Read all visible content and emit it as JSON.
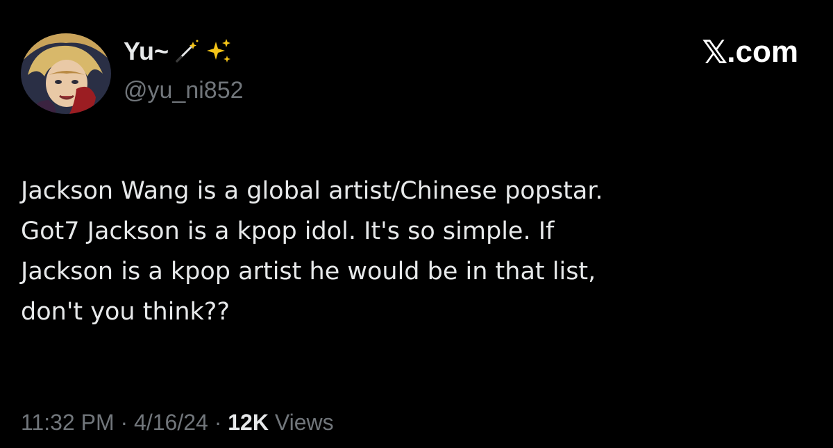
{
  "author": {
    "display_name": "Yu~",
    "name_emojis": [
      "magic-wand-icon",
      "sparkles-icon"
    ],
    "handle": "@yu_ni852"
  },
  "brand": {
    "mark": "𝕏",
    "text": ".com"
  },
  "tweet": {
    "lines": [
      "Jackson Wang is a global artist/Chinese popstar.",
      "Got7 Jackson is a kpop idol. It's so simple. If",
      "Jackson is a kpop artist he would be in that list,",
      "don't you think??"
    ]
  },
  "meta": {
    "time": "11:32 PM",
    "separator": " · ",
    "date": "4/16/24",
    "views_count": "12K",
    "views_label": "Views"
  },
  "colors": {
    "background": "#000000",
    "primary_text": "#e7e9ea",
    "secondary_text": "#71767b",
    "sparkle": "#f5c518"
  }
}
